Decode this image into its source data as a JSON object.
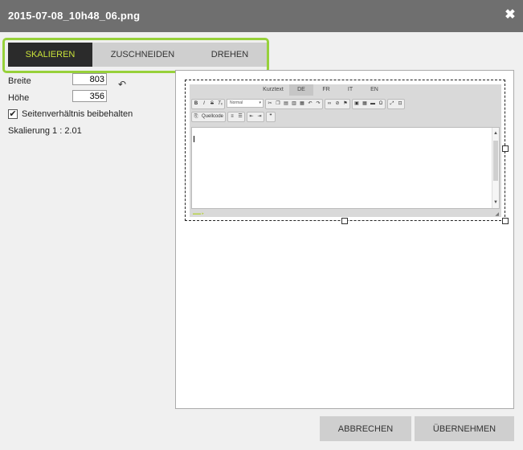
{
  "window": {
    "title": "2015-07-08_10h48_06.png",
    "close_glyph": "✖"
  },
  "tabs": [
    {
      "label": "SKALIEREN",
      "active": true
    },
    {
      "label": "ZUSCHNEIDEN",
      "active": false
    },
    {
      "label": "DREHEN",
      "active": false
    }
  ],
  "form": {
    "width_label": "Breite",
    "width_value": "803",
    "height_label": "Höhe",
    "height_value": "356",
    "keep_ratio_label": "Seitenverhältnis beibehalten",
    "keep_ratio_checked": true,
    "scale_text": "Skalierung 1 : 2.01"
  },
  "editor": {
    "lang_tabs": [
      "Kurztext",
      "DE",
      "FR",
      "IT",
      "EN"
    ],
    "active_lang": "DE",
    "format_select": "Normal",
    "source_button": "Quellcode"
  },
  "buttons": {
    "cancel": "ABBRECHEN",
    "apply": "ÜBERNEHMEN"
  },
  "colors": {
    "titlebar": "#6f6f6f",
    "highlight": "#97d13a",
    "active_tab_bg": "#2b2b2b",
    "active_tab_text": "#c9e23a"
  }
}
